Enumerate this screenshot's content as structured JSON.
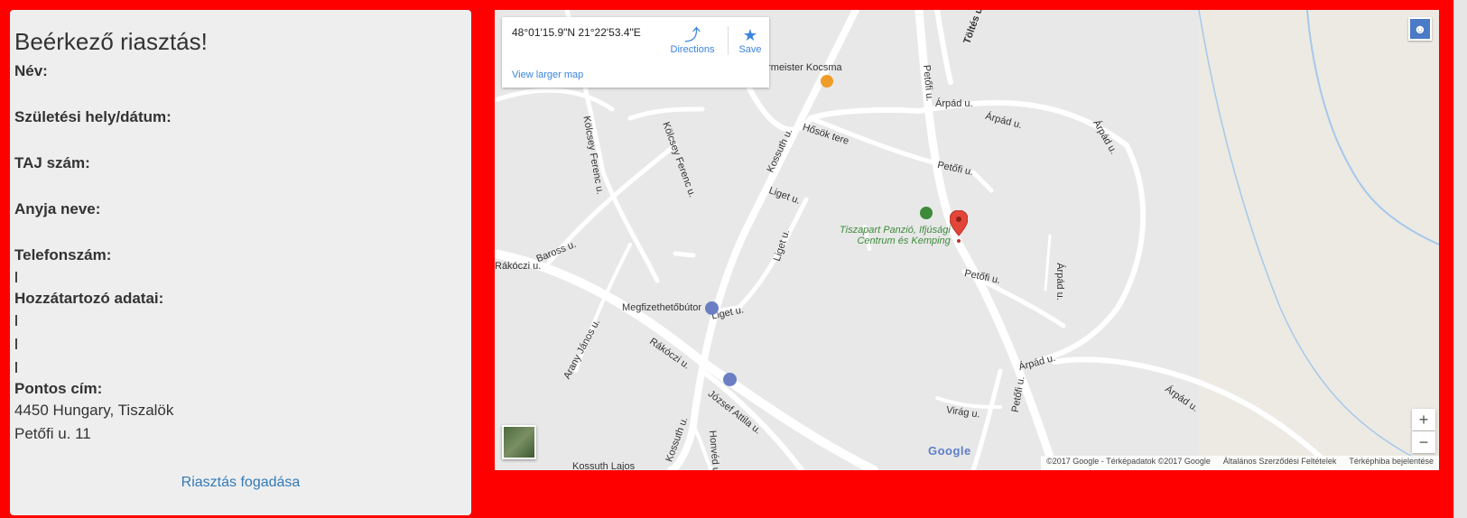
{
  "alert": {
    "title": "Beérkező riasztás!",
    "name_label": "Név:",
    "birth_label": "Születési hely/dátum:",
    "taj_label": "TAJ szám:",
    "mother_label": "Anyja neve:",
    "phone_label": "Telefonszám:",
    "relative_label": "Hozzátartozó adatai:",
    "address_label": "Pontos cím:",
    "address_line1": "4450 Hungary, Tiszalök",
    "address_line2": "Petőfi u. 11",
    "accept_link": "Riasztás fogadása"
  },
  "map": {
    "coordinates": "48°01'15.9\"N 21°22'53.4\"E",
    "directions_label": "Directions",
    "save_label": "Save",
    "larger_map_link": "View larger map",
    "places": {
      "kocsma": "ermeister Kocsma",
      "panzio_line1": "Tiszapart Panzió, Ifjúsági",
      "panzio_line2": "Centrum és Kemping",
      "butor": "Megfizethetőbútor",
      "kossuth_lajos": "Kossuth Lajos"
    },
    "streets": {
      "petofi": "Petőfi u.",
      "arpad": "Árpád u.",
      "hosok": "Hősök tere",
      "kossuth": "Kossuth u.",
      "kolcsey": "Kölcsey Ferenc u.",
      "liget": "Liget u.",
      "rakoczi": "Rákóczi u.",
      "baross": "Baross u.",
      "arany": "Arany János u.",
      "jozsef": "József Attila u.",
      "virag": "Virág u.",
      "honved": "Honvéd u.",
      "toltes": "Töltés u."
    },
    "zoom_in": "+",
    "zoom_out": "−",
    "google_logo": "Google",
    "footer": [
      "©2017 Google - Térképadatok ©2017 Google",
      "Általános Szerződési Feltételek",
      "Térképhiba bejelentése"
    ],
    "marker_color": "#e2463a",
    "park_color": "#3d8b3a"
  }
}
